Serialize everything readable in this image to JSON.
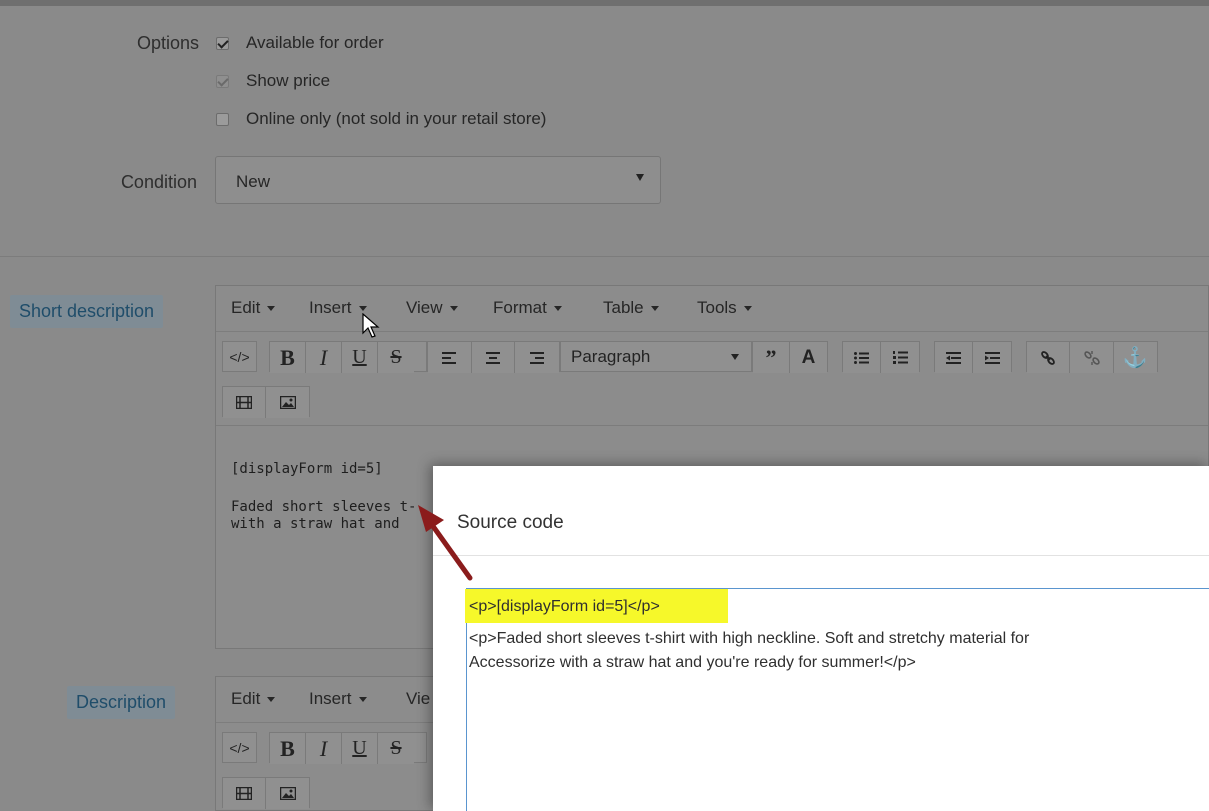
{
  "options": {
    "label": "Options",
    "items": [
      {
        "label": "Available for order",
        "checked": true,
        "disabled": false
      },
      {
        "label": "Show price",
        "checked": true,
        "disabled": true
      },
      {
        "label": "Online only (not sold in your retail store)",
        "checked": false,
        "disabled": false
      }
    ]
  },
  "condition": {
    "label": "Condition",
    "value": "New"
  },
  "short_description": {
    "label": "Short description",
    "menus": [
      "Edit",
      "Insert",
      "View",
      "Format",
      "Table",
      "Tools"
    ],
    "format_select": "Paragraph",
    "content": {
      "line1": "[displayForm id=5]",
      "line2": "Faded short sleeves t-",
      "line3": "with a straw hat and"
    }
  },
  "description": {
    "label": "Description",
    "menus": [
      "Edit",
      "Insert",
      "Vie"
    ]
  },
  "source_modal": {
    "title": "Source code",
    "line1": "<p>[displayForm id=5]</p>",
    "line2": "<p>Faded short sleeves t-shirt with high neckline. Soft and stretchy material for",
    "line3": "Accessorize with a straw hat and you're ready for summer!</p>"
  },
  "icons": {
    "code": "code-icon",
    "bold": "bold-icon",
    "italic": "italic-icon",
    "underline": "underline-icon",
    "strike": "strikethrough-icon",
    "align_left": "align-left-icon",
    "align_center": "align-center-icon",
    "align_right": "align-right-icon",
    "quote": "blockquote-icon",
    "color": "text-color-icon",
    "ul": "bullet-list-icon",
    "ol": "numbered-list-icon",
    "outdent": "outdent-icon",
    "indent": "indent-icon",
    "link": "link-icon",
    "unlink": "unlink-icon",
    "anchor": "anchor-icon",
    "media": "media-icon",
    "image": "image-icon"
  },
  "colors": {
    "highlight": "#f6f82a",
    "arrow": "#8b1c1c",
    "badge_text": "#1f4d6a"
  }
}
